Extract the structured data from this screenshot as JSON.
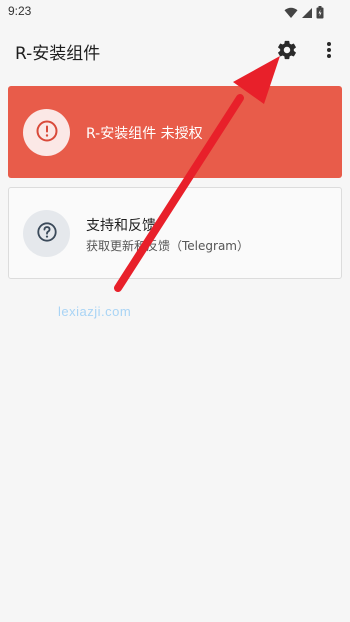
{
  "status_bar": {
    "time": "9:23",
    "icons": [
      "wifi-icon",
      "signal-icon",
      "battery-icon"
    ]
  },
  "app_bar": {
    "title": "R-安装组件",
    "actions": [
      "settings-icon",
      "more-vert-icon"
    ]
  },
  "cards": {
    "unauthorized": {
      "title": "R-安装组件 未授权",
      "icon": "alert-circle-icon",
      "color": "#e85c4a"
    },
    "support": {
      "title": "支持和反馈",
      "subtitle": "获取更新和反馈（Telegram）",
      "icon": "help-circle-icon"
    }
  },
  "watermark": "lexiazji.com",
  "annotation": {
    "type": "arrow",
    "color": "#e8202a",
    "points_to": "settings-button"
  }
}
